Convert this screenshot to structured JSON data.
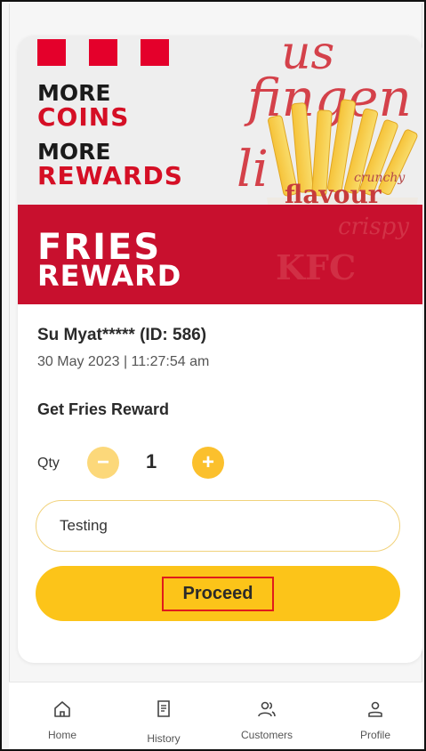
{
  "banner": {
    "line1": "MORE",
    "line2": "COINS",
    "line3": "MORE",
    "line4": "REWARDS",
    "title1": "FRIES",
    "title2": "REWARD",
    "script_top": "fingen",
    "script_top_prefix": "us",
    "script_side": "li",
    "script_flavour": "flavour",
    "script_crunchy": "crunchy",
    "script_crispy": "crispy",
    "script_kfc": "KFC"
  },
  "user": {
    "name": "Su Myat***** (ID: 586)",
    "datetime": "30 May 2023 | 11:27:54 am"
  },
  "reward": {
    "title": "Get Fries Reward",
    "qty_label": "Qty",
    "qty_value": "1",
    "note_value": "Testing",
    "proceed_label": "Proceed"
  },
  "colors": {
    "brand_red": "#c8102e",
    "accent_yellow": "#fcc419"
  },
  "nav": [
    {
      "label": "Home",
      "icon": "home-icon"
    },
    {
      "label": "History",
      "icon": "receipt-icon"
    },
    {
      "label": "Customers",
      "icon": "customers-icon"
    },
    {
      "label": "Profile",
      "icon": "profile-icon"
    }
  ]
}
